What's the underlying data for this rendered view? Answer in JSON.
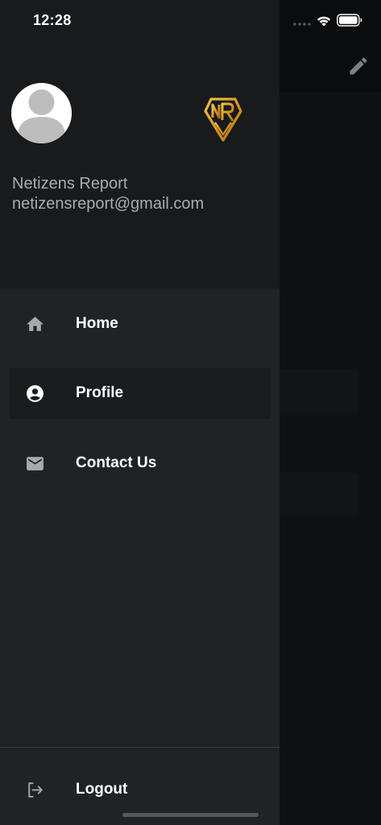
{
  "status_bar": {
    "time": "12:28",
    "signal_icon": "signal-dots-icon",
    "wifi_icon": "wifi-icon",
    "battery_icon": "battery-icon"
  },
  "background_screen": {
    "edit_icon": "pencil-icon"
  },
  "drawer": {
    "header": {
      "avatar_icon": "default-avatar-icon",
      "logo_text": "NR",
      "account_name": "Netizens Report",
      "account_email": "netizensreport@gmail.com"
    },
    "menu": [
      {
        "label": "Home",
        "icon": "home-icon",
        "selected": false
      },
      {
        "label": "Profile",
        "icon": "account-circle-icon",
        "selected": true
      },
      {
        "label": "Contact Us",
        "icon": "mail-icon",
        "selected": false
      }
    ],
    "footer": {
      "logout_label": "Logout",
      "logout_icon": "logout-icon"
    }
  },
  "colors": {
    "drawer_bg": "#202326",
    "header_bg": "#181a1c",
    "selected_bg": "#1a1c1e",
    "logo_gold": "#d9a020",
    "icon_gray": "#a7aaad",
    "text_primary": "#ffffff",
    "text_secondary": "#a9acae"
  }
}
